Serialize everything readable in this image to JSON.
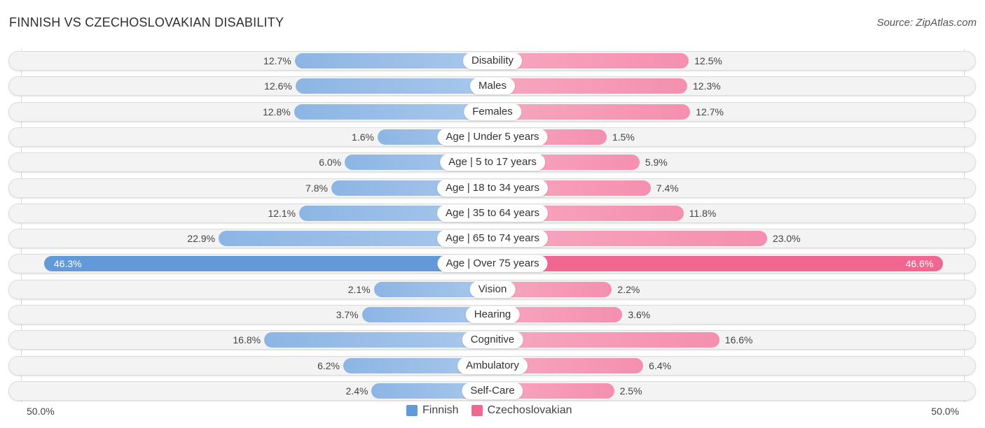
{
  "header": {
    "title": "FINNISH VS CZECHOSLOVAKIAN DISABILITY",
    "source": "Source: ZipAtlas.com"
  },
  "chart_data": {
    "type": "bar",
    "orientation": "diverging-horizontal",
    "title": "FINNISH VS CZECHOSLOVAKIAN DISABILITY",
    "categories": [
      "Disability",
      "Males",
      "Females",
      "Age | Under 5 years",
      "Age | 5 to 17 years",
      "Age | 18 to 34 years",
      "Age | 35 to 64 years",
      "Age | 65 to 74 years",
      "Age | Over 75 years",
      "Vision",
      "Hearing",
      "Cognitive",
      "Ambulatory",
      "Self-Care"
    ],
    "series": [
      {
        "name": "Finnish",
        "color": "#6399d9",
        "side": "left",
        "values": [
          12.7,
          12.6,
          12.8,
          1.6,
          6.0,
          7.8,
          12.1,
          22.9,
          46.3,
          2.1,
          3.7,
          16.8,
          6.2,
          2.4
        ],
        "labels": [
          "12.7%",
          "12.6%",
          "12.8%",
          "1.6%",
          "6.0%",
          "7.8%",
          "12.1%",
          "22.9%",
          "46.3%",
          "2.1%",
          "3.7%",
          "16.8%",
          "6.2%",
          "2.4%"
        ]
      },
      {
        "name": "Czechoslovakian",
        "color": "#f06892",
        "side": "right",
        "values": [
          12.5,
          12.3,
          12.7,
          1.5,
          5.9,
          7.4,
          11.8,
          23.0,
          46.6,
          2.2,
          3.6,
          16.6,
          6.4,
          2.5
        ],
        "labels": [
          "12.5%",
          "12.3%",
          "12.7%",
          "1.5%",
          "5.9%",
          "7.4%",
          "11.8%",
          "23.0%",
          "46.6%",
          "2.2%",
          "3.6%",
          "16.6%",
          "6.4%",
          "2.5%"
        ]
      }
    ],
    "xlim": [
      0,
      50
    ],
    "axis_labels": {
      "left": "50.0%",
      "right": "50.0%"
    },
    "legend": {
      "position": "bottom-center",
      "entries": [
        "Finnish",
        "Czechoslovakian"
      ]
    },
    "highlight_index": 8
  }
}
